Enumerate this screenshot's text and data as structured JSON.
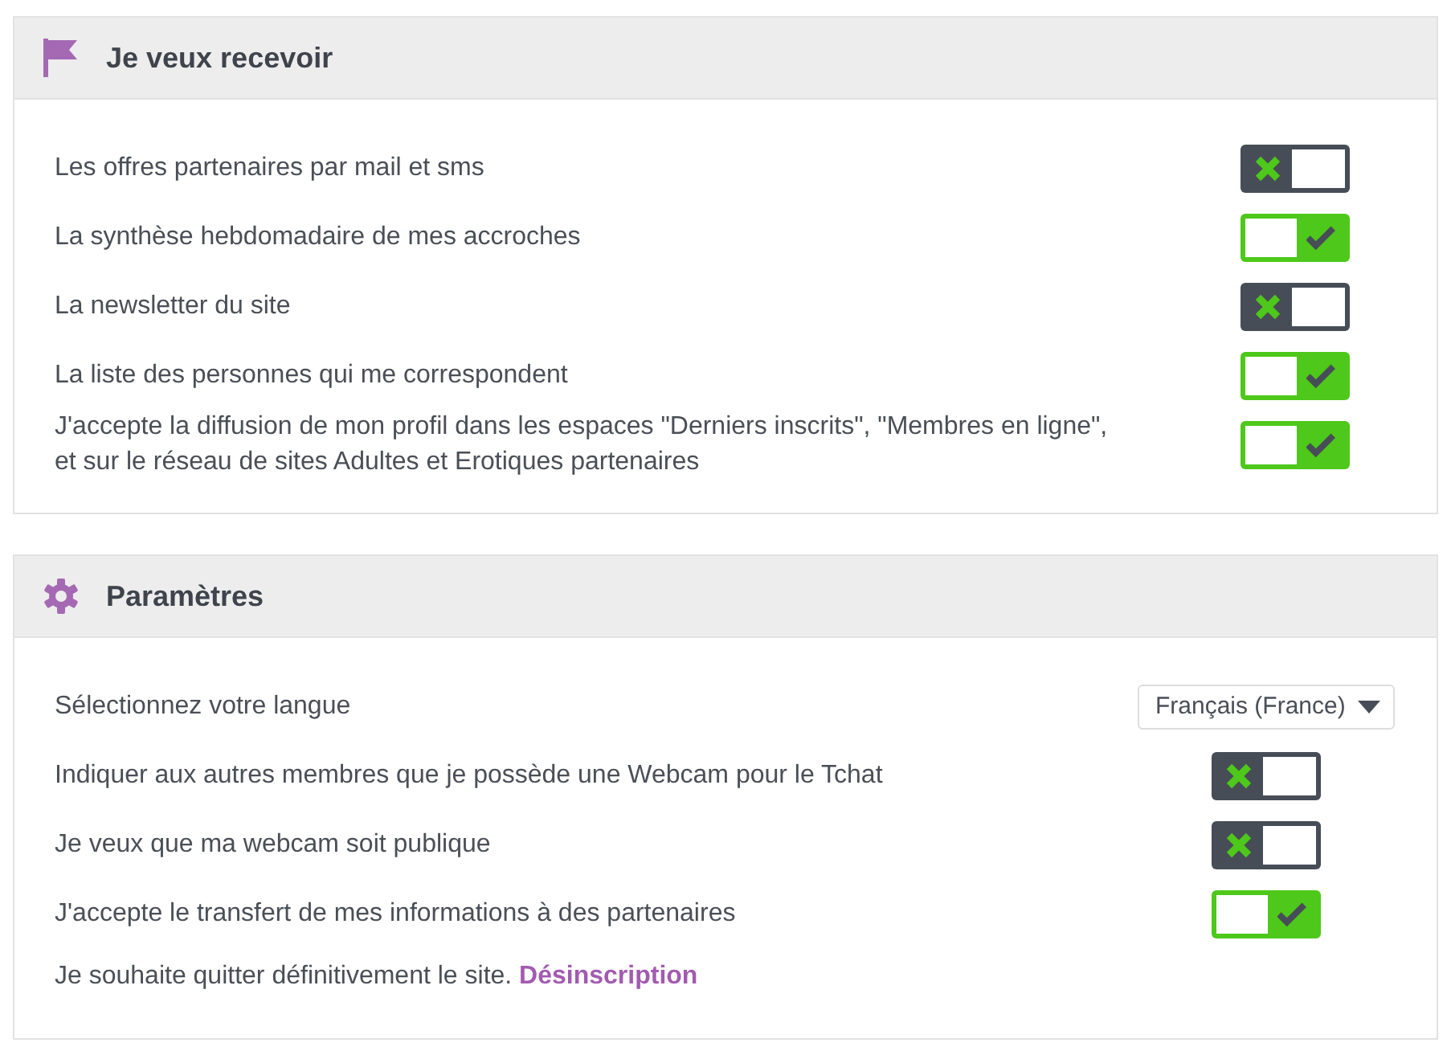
{
  "panels": [
    {
      "title": "Je veux recevoir",
      "rows": [
        {
          "kind": "toggle",
          "label": "Les offres partenaires par mail et sms",
          "checked": false
        },
        {
          "kind": "toggle",
          "label": "La synthèse hebdomadaire de mes accroches",
          "checked": true
        },
        {
          "kind": "toggle",
          "label": "La newsletter du site",
          "checked": false
        },
        {
          "kind": "toggle",
          "label": "La liste des personnes qui me correspondent",
          "checked": true
        },
        {
          "kind": "toggle",
          "label": "J'accepte la diffusion de mon profil dans les espaces \"Derniers inscrits\", \"Membres en ligne\", et sur le réseau de sites Adultes et Erotiques partenaires",
          "checked": true
        }
      ]
    },
    {
      "title": "Paramètres",
      "rows": [
        {
          "kind": "select",
          "label": "Sélectionnez votre langue",
          "value": "Français (France)"
        },
        {
          "kind": "toggle",
          "label": "Indiquer aux autres membres que je possède une Webcam pour le Tchat",
          "checked": false
        },
        {
          "kind": "toggle",
          "label": "Je veux que ma webcam soit publique",
          "checked": false
        },
        {
          "kind": "toggle",
          "label": "J'accepte le transfert de mes informations à des partenaires",
          "checked": true
        },
        {
          "kind": "link",
          "label": "Je souhaite quitter définitivement le site.",
          "link": "Désinscription"
        }
      ]
    }
  ]
}
